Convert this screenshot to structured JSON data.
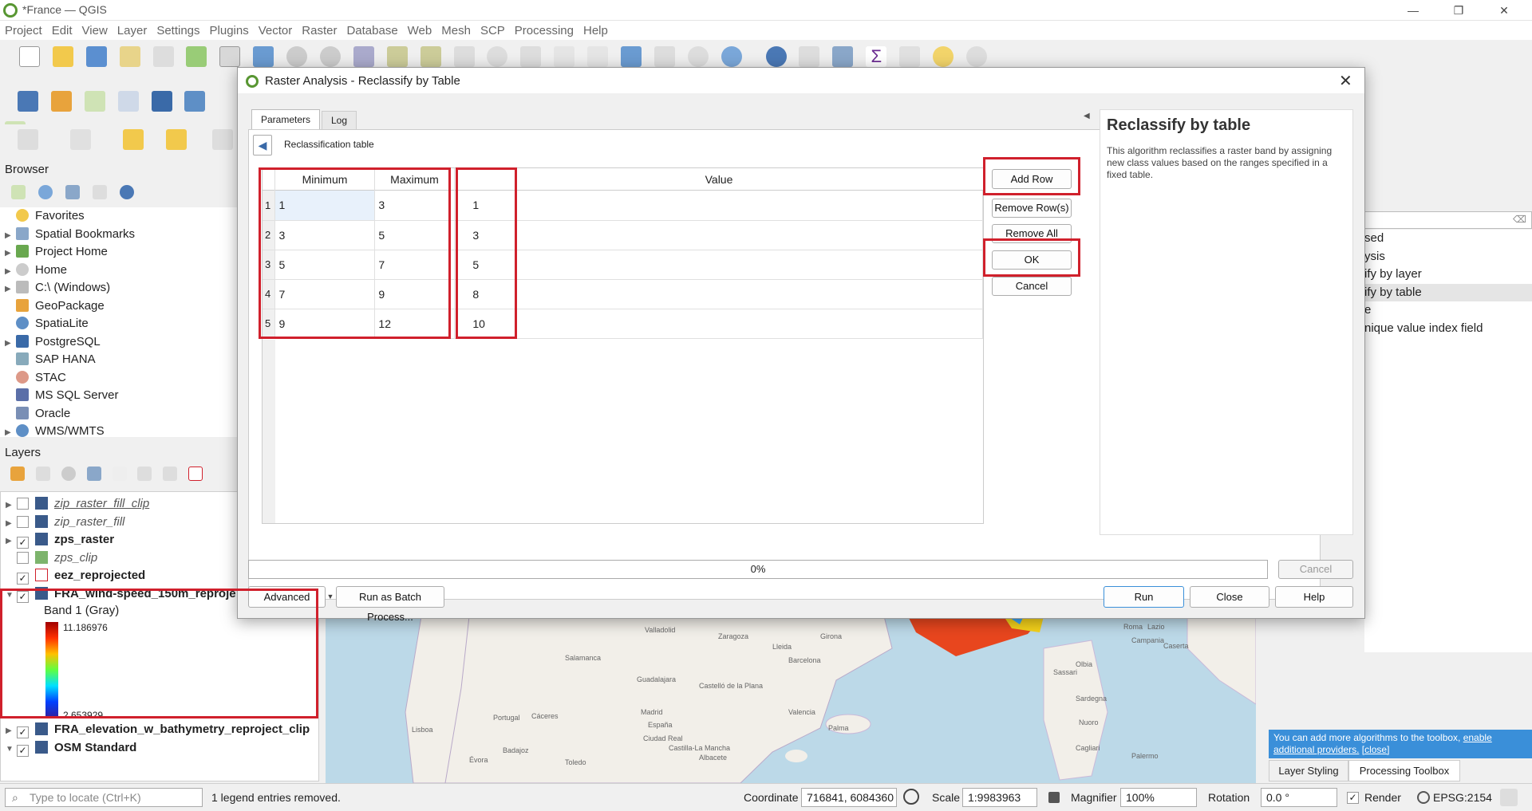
{
  "window": {
    "title": "*France — QGIS"
  },
  "menu": [
    "Project",
    "Edit",
    "View",
    "Layer",
    "Settings",
    "Plugins",
    "Vector",
    "Raster",
    "Database",
    "Web",
    "Mesh",
    "SCP",
    "Processing",
    "Help"
  ],
  "browser": {
    "title": "Browser",
    "items": [
      {
        "label": "Favorites",
        "expand": false
      },
      {
        "label": "Spatial Bookmarks",
        "expand": true
      },
      {
        "label": "Project Home",
        "expand": true
      },
      {
        "label": "Home",
        "expand": true
      },
      {
        "label": "C:\\ (Windows)",
        "expand": true
      },
      {
        "label": "GeoPackage",
        "expand": false
      },
      {
        "label": "SpatiaLite",
        "expand": false
      },
      {
        "label": "PostgreSQL",
        "expand": true
      },
      {
        "label": "SAP HANA",
        "expand": false
      },
      {
        "label": "STAC",
        "expand": false
      },
      {
        "label": "MS SQL Server",
        "expand": false
      },
      {
        "label": "Oracle",
        "expand": false
      },
      {
        "label": "WMS/WMTS",
        "expand": true
      }
    ]
  },
  "layers": {
    "title": "Layers",
    "items": [
      {
        "label": "zip_raster_fill_clip",
        "checked": false,
        "style": "italic-underline"
      },
      {
        "label": "zip_raster_fill",
        "checked": false,
        "style": "italic"
      },
      {
        "label": "zps_raster",
        "checked": true,
        "style": "bold"
      },
      {
        "label": "zps_clip",
        "checked": false,
        "style": "italic"
      },
      {
        "label": "eez_reprojected",
        "checked": true,
        "style": "bold"
      },
      {
        "label": "FRA_wind-speed_150m_reproje",
        "checked": true,
        "style": "bold"
      }
    ],
    "band_label": "Band 1 (Gray)",
    "legend_max": "11.186976",
    "legend_min": "2.653929",
    "bottom_items": [
      {
        "label": "FRA_elevation_w_bathymetry_reproject_clip",
        "checked": true
      },
      {
        "label": "OSM Standard",
        "checked": true
      }
    ]
  },
  "dialog": {
    "title": "Raster Analysis - Reclassify by Table",
    "tabs": [
      "Parameters",
      "Log"
    ],
    "param_label": "Reclassification table",
    "columns": [
      "Minimum",
      "Maximum",
      "Value"
    ],
    "rows": [
      {
        "n": "1",
        "min": "1",
        "max": "3",
        "value": "1"
      },
      {
        "n": "2",
        "min": "3",
        "max": "5",
        "value": "3"
      },
      {
        "n": "3",
        "min": "5",
        "max": "7",
        "value": "5"
      },
      {
        "n": "4",
        "min": "7",
        "max": "9",
        "value": "8"
      },
      {
        "n": "5",
        "min": "9",
        "max": "12",
        "value": "10"
      }
    ],
    "buttons": {
      "add_row": "Add Row",
      "remove_rows": "Remove Row(s)",
      "remove_all": "Remove All",
      "ok": "OK",
      "cancel": "Cancel"
    },
    "help_title": "Reclassify by table",
    "help_text": "This algorithm reclassifies a raster band by assigning new class values based on the ranges specified in a fixed table.",
    "progress": "0%",
    "progress_fraction": 0,
    "bottom": {
      "advanced": "Advanced",
      "batch": "Run as Batch Process...",
      "cancel": "Cancel",
      "run": "Run",
      "close": "Close",
      "help": "Help"
    }
  },
  "toolbox": {
    "items": [
      "sed",
      "ysis",
      "ify by layer",
      "ify by table",
      "e",
      "nique value index field"
    ],
    "info_text": "You can add more algorithms to the toolbox, ",
    "info_link": "enable additional providers.",
    "info_close": "[close]",
    "tabs": [
      "Layer Styling",
      "Processing Toolbox"
    ]
  },
  "map_labels": [
    "Valladolid",
    "Zaragoza",
    "Lleida",
    "Girona",
    "Barcelona",
    "Salamanca",
    "Guadalajara",
    "Madrid",
    "Castelló de la Plana",
    "Portugal",
    "España",
    "Cáceres",
    "Valencia",
    "Lisboa",
    "Ciudad Real",
    "Palma",
    "Badajoz",
    "Albacete",
    "Sassari",
    "Sardegna",
    "Cagliari",
    "Palermo",
    "Nuoro",
    "Olbia",
    "Campania",
    "Caserta",
    "Roma",
    "Lazio",
    "Castilla-La Mancha",
    "Évora",
    "Toledo"
  ],
  "status": {
    "locate_placeholder": "Type to locate (Ctrl+K)",
    "message": "1 legend entries removed.",
    "coordinate_label": "Coordinate",
    "coordinate": "716841, 6084360",
    "scale_label": "Scale",
    "scale": "1:9983963",
    "magnifier_label": "Magnifier",
    "magnifier": "100%",
    "rotation_label": "Rotation",
    "rotation": "0.0 °",
    "render_label": "Render",
    "crs": "EPSG:2154"
  },
  "colors": {
    "highlight": "#d0202c",
    "qgis_green": "#589632",
    "info_bg": "#3a8fd9"
  }
}
